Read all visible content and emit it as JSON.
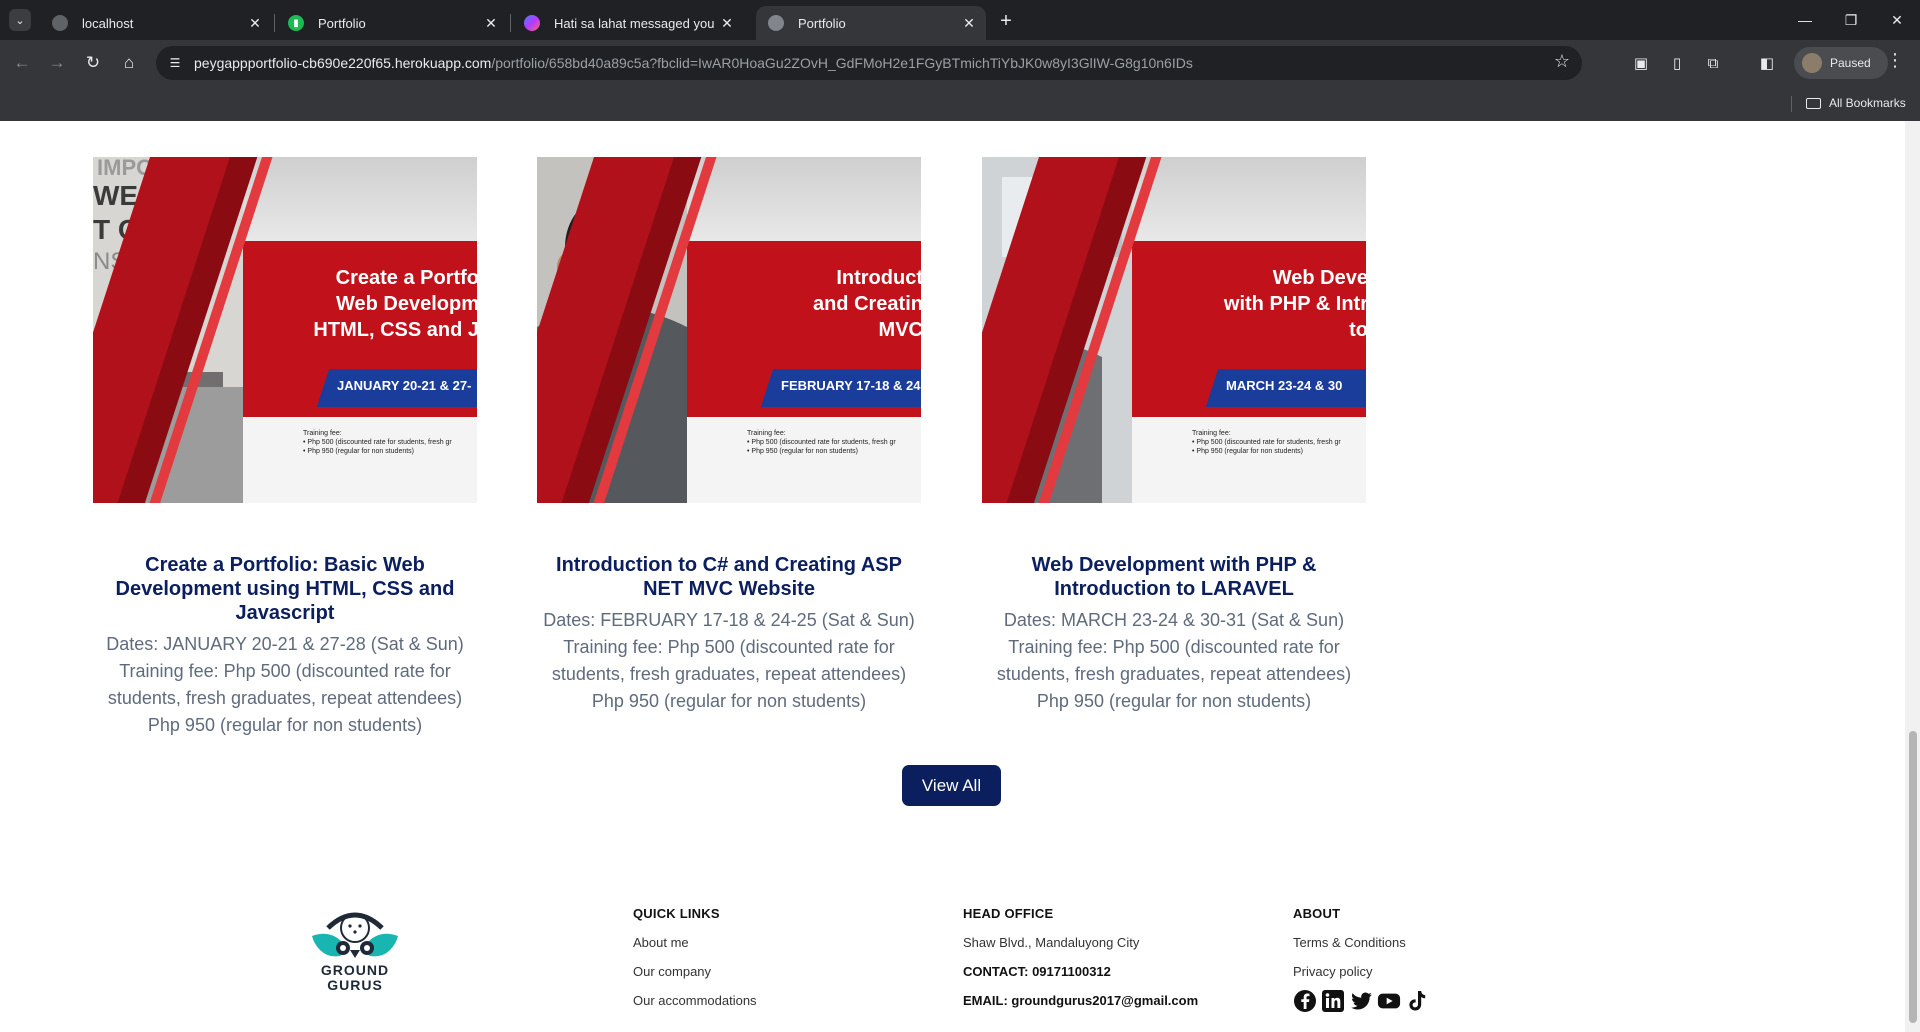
{
  "browser": {
    "tabs": [
      {
        "title": "localhost",
        "active": false
      },
      {
        "title": "Portfolio",
        "active": false
      },
      {
        "title": "Hati sa lahat messaged you",
        "active": false
      },
      {
        "title": "Portfolio",
        "active": true
      }
    ],
    "url_host": "peygappportfolio-cb690e220f65.herokuapp.com",
    "url_path": "/portfolio/658bd40a89c5a?fbclid=IwAR0HoaGu2ZOvH_GdFMoH2e1FGyBTmichTiYbJK0w8yI3GlIW-G8g10n6IDs",
    "profile_status": "Paused",
    "bookmarks_label": "All Bookmarks"
  },
  "cards": [
    {
      "poster_heading": "Create a Portfo\nWeb Developm\nHTML, CSS and J",
      "poster_date": "JANUARY 20-21 & 27-",
      "poster_fee": "Training fee:\n• Php 500 (discounted rate for students, fresh gr\n• Php 950 (regular for non students)",
      "title": "Create a Portfolio: Basic Web Development using HTML, CSS and Javascript",
      "dates": "Dates: JANUARY 20-21 & 27-28 (Sat & Sun)",
      "fee1": "Training fee: Php 500 (discounted rate for students, fresh graduates, repeat attendees)",
      "fee2": "Php 950 (regular for non students)"
    },
    {
      "poster_heading": "Introduct\nand Creatin\nMVC",
      "poster_date": "FEBRUARY 17-18 & 24",
      "poster_fee": "Training fee:\n• Php 500 (discounted rate for students, fresh gr\n• Php 950 (regular for non students)",
      "title": "Introduction to C# and Creating ASP NET MVC Website",
      "dates": "Dates: FEBRUARY 17-18 & 24-25 (Sat & Sun)",
      "fee1": "Training fee: Php 500 (discounted rate for students, fresh graduates, repeat attendees)",
      "fee2": "Php 950 (regular for non students)"
    },
    {
      "poster_heading": "Web Deve\nwith PHP & Intr\nto",
      "poster_date": "MARCH 23-24 & 30",
      "poster_fee": "Training fee:\n• Php 500 (discounted rate for students, fresh gr\n• Php 950 (regular for non students)",
      "title": "Web Development with PHP & Introduction to LARAVEL",
      "dates": "Dates: MARCH 23-24 & 30-31 (Sat & Sun)",
      "fee1": "Training fee: Php 500 (discounted rate for students, fresh graduates, repeat attendees)",
      "fee2": "Php 950 (regular for non students)"
    }
  ],
  "view_all_label": "View All",
  "footer": {
    "logo_text": "GROUND\nGURUS",
    "quick_links": {
      "heading": "QUICK LINKS",
      "items": [
        "About me",
        "Our company",
        "Our accommodations"
      ]
    },
    "head_office": {
      "heading": "HEAD OFFICE",
      "address": "Shaw Blvd., Mandaluyong City",
      "contact": "CONTACT: 09171100312",
      "email": "EMAIL: groundgurus2017@gmail.com"
    },
    "about": {
      "heading": "ABOUT",
      "items": [
        "Terms & Conditions",
        "Privacy policy"
      ],
      "socials": [
        "facebook-icon",
        "linkedin-icon",
        "twitter-icon",
        "youtube-icon",
        "tiktok-icon"
      ]
    }
  },
  "colors": {
    "brand_navy": "#0b1f5e",
    "poster_red": "#c1121b",
    "poster_blue": "#1a3c9b",
    "body_text": "#5f6b7d"
  }
}
